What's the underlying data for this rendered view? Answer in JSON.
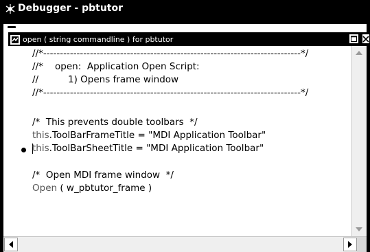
{
  "window": {
    "title": "Debugger - pbtutor"
  },
  "document": {
    "title": "open ( string commandline ) for pbtutor"
  },
  "code": {
    "lines": [
      "//*-----------------------------------------------------------------------------*/",
      "//*    open:  Application Open Script:",
      "//          1) Opens frame window",
      "//*-----------------------------------------------------------------------------*/",
      "",
      "/*  This prevents double toolbars  */",
      ".ToolBarFrameTitle = \"MDI Application Toolbar\"",
      ".ToolBarSheetTitle = \"MDI Application Toolbar\"",
      "",
      "/*  Open MDI frame window  */",
      " ( w_pbtutor_frame )"
    ],
    "keywords": [
      "this",
      "this",
      "Open"
    ],
    "breakpoint_line_number": 8
  },
  "colors": {
    "titlebar_bg": "#000000",
    "keyword": "#555555",
    "text": "#000000"
  },
  "icons": {
    "app": "bug-icon",
    "document": "script-icon",
    "restore": "restore-icon",
    "close": "close-icon",
    "breakpoint": "breakpoint-dot-icon"
  }
}
